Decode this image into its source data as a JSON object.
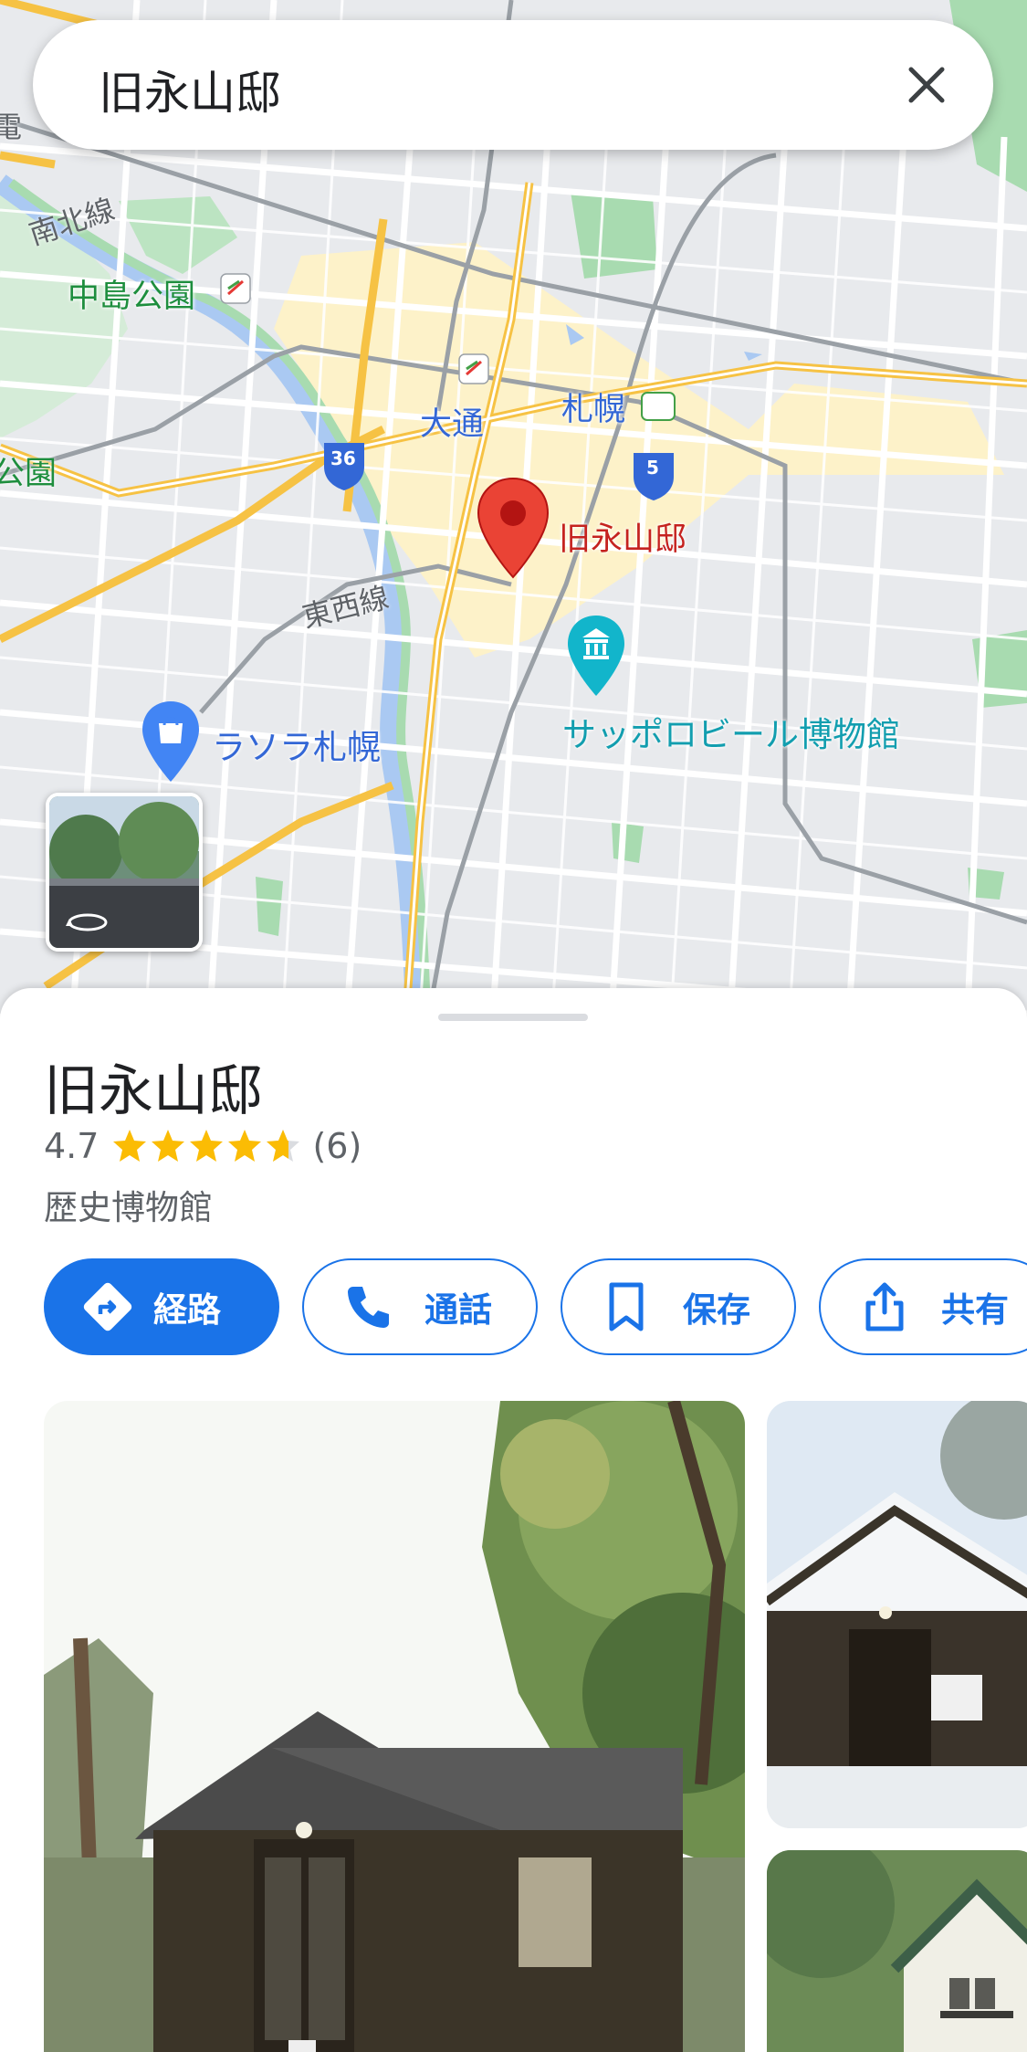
{
  "search": {
    "query": "旧永山邸"
  },
  "map": {
    "place_marker_label": "旧永山邸",
    "labels": {
      "nakajima_park": "中島公園",
      "nanboku_line": "南北線",
      "tozai_line": "東西線",
      "odori": "大通",
      "sapporo": "札幌",
      "lasora": "ラソラ札幌",
      "beer_museum": "サッポロビール博物館",
      "park_edge": "公園",
      "edge_char": "電",
      "route_36": "36",
      "route_5": "5"
    }
  },
  "place": {
    "name": "旧永山邸",
    "rating": "4.7",
    "review_count": "(6)",
    "category": "歴史博物館"
  },
  "actions": {
    "directions": "経路",
    "call": "通話",
    "save": "保存",
    "share": "共有"
  },
  "icons": {
    "close": "close-icon",
    "directions": "directions-icon",
    "phone": "phone-icon",
    "bookmark": "bookmark-icon",
    "share": "share-icon",
    "street_view": "street-view-rotate-icon",
    "shopping": "shopping-bag-icon",
    "museum": "museum-icon",
    "place_pin": "place-pin-icon"
  },
  "colors": {
    "accent": "#1a73e8",
    "pin": "#ea4335",
    "star": "#fbbc04",
    "museum": "#12b5cb"
  }
}
